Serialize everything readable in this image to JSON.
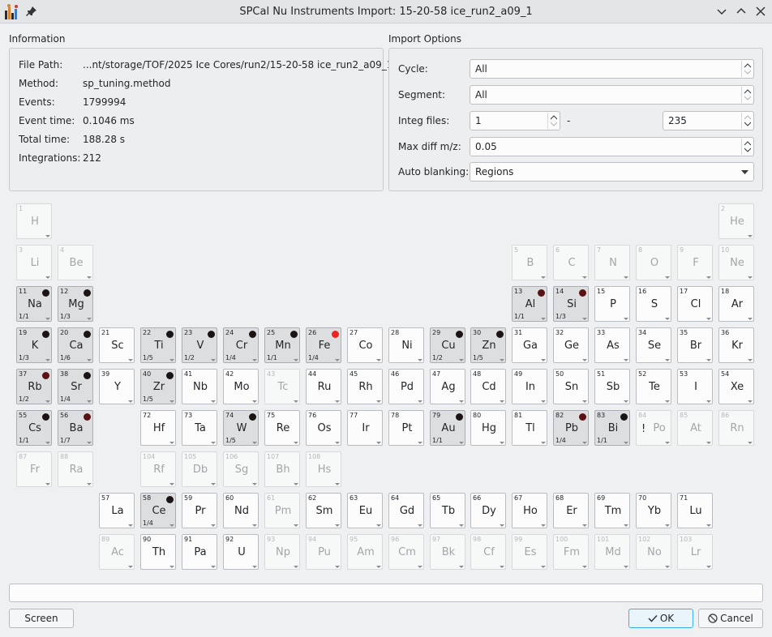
{
  "window": {
    "title": "SPCal Nu Instruments Import: 15-20-58 ice_run2_a09_1"
  },
  "information": {
    "title": "Information",
    "rows": [
      {
        "label": "File Path:",
        "value": "...nt/storage/TOF/2025 Ice Cores/run2/15-20-58 ice_run2_a09_1"
      },
      {
        "label": "Method:",
        "value": "sp_tuning.method"
      },
      {
        "label": "Events:",
        "value": "1799994"
      },
      {
        "label": "Event time:",
        "value": "0.1046 ms"
      },
      {
        "label": "Total time:",
        "value": "188.28 s"
      },
      {
        "label": "Integrations:",
        "value": "212"
      }
    ]
  },
  "import_options": {
    "title": "Import Options",
    "cycle": {
      "label": "Cycle:",
      "value": "All"
    },
    "segment": {
      "label": "Segment:",
      "value": "All"
    },
    "integ_files": {
      "label": "Integ files:",
      "from": "1",
      "separator": "-",
      "to": "235"
    },
    "max_diff": {
      "label": "Max diff m/z:",
      "value": "0.05"
    },
    "auto_blanking": {
      "label": "Auto blanking:",
      "value": "Regions"
    }
  },
  "colors": {
    "dot_dark": "#1a1414",
    "dot_darkred": "#5b1212",
    "dot_red": "#ef2222"
  },
  "elements": [
    {
      "n": "1",
      "s": "H",
      "st": "dis"
    },
    {
      "n": "2",
      "s": "He",
      "st": "dis"
    },
    {
      "n": "3",
      "s": "Li",
      "st": "dis"
    },
    {
      "n": "4",
      "s": "Be",
      "st": "dis"
    },
    {
      "n": "5",
      "s": "B",
      "st": "dis"
    },
    {
      "n": "6",
      "s": "C",
      "st": "dis"
    },
    {
      "n": "7",
      "s": "N",
      "st": "dis"
    },
    {
      "n": "8",
      "s": "O",
      "st": "dis"
    },
    {
      "n": "9",
      "s": "F",
      "st": "dis"
    },
    {
      "n": "10",
      "s": "Ne",
      "st": "dis"
    },
    {
      "n": "11",
      "s": "Na",
      "st": "sel",
      "r": "1/1",
      "d": "dark"
    },
    {
      "n": "12",
      "s": "Mg",
      "st": "sel",
      "r": "1/3",
      "d": "dark"
    },
    {
      "n": "13",
      "s": "Al",
      "st": "sel",
      "r": "1/1",
      "d": "darkred"
    },
    {
      "n": "14",
      "s": "Si",
      "st": "sel",
      "r": "1/3",
      "d": "darkred"
    },
    {
      "n": "15",
      "s": "P",
      "st": "en"
    },
    {
      "n": "16",
      "s": "S",
      "st": "en"
    },
    {
      "n": "17",
      "s": "Cl",
      "st": "en"
    },
    {
      "n": "18",
      "s": "Ar",
      "st": "en"
    },
    {
      "n": "19",
      "s": "K",
      "st": "sel",
      "r": "1/3",
      "d": "dark"
    },
    {
      "n": "20",
      "s": "Ca",
      "st": "sel",
      "r": "1/6",
      "d": "dark"
    },
    {
      "n": "21",
      "s": "Sc",
      "st": "en"
    },
    {
      "n": "22",
      "s": "Ti",
      "st": "sel",
      "r": "1/5",
      "d": "dark"
    },
    {
      "n": "23",
      "s": "V",
      "st": "sel",
      "r": "1/2",
      "d": "dark"
    },
    {
      "n": "24",
      "s": "Cr",
      "st": "sel",
      "r": "1/4",
      "d": "dark"
    },
    {
      "n": "25",
      "s": "Mn",
      "st": "sel",
      "r": "1/1",
      "d": "dark"
    },
    {
      "n": "26",
      "s": "Fe",
      "st": "sel",
      "r": "1/4",
      "d": "red"
    },
    {
      "n": "27",
      "s": "Co",
      "st": "en"
    },
    {
      "n": "28",
      "s": "Ni",
      "st": "en"
    },
    {
      "n": "29",
      "s": "Cu",
      "st": "sel",
      "r": "1/2",
      "d": "dark"
    },
    {
      "n": "30",
      "s": "Zn",
      "st": "sel",
      "r": "1/5",
      "d": "dark"
    },
    {
      "n": "31",
      "s": "Ga",
      "st": "en"
    },
    {
      "n": "32",
      "s": "Ge",
      "st": "en"
    },
    {
      "n": "33",
      "s": "As",
      "st": "en"
    },
    {
      "n": "34",
      "s": "Se",
      "st": "en"
    },
    {
      "n": "35",
      "s": "Br",
      "st": "en"
    },
    {
      "n": "36",
      "s": "Kr",
      "st": "en"
    },
    {
      "n": "37",
      "s": "Rb",
      "st": "sel",
      "r": "1/2",
      "d": "darkred"
    },
    {
      "n": "38",
      "s": "Sr",
      "st": "sel",
      "r": "1/4",
      "d": "dark"
    },
    {
      "n": "39",
      "s": "Y",
      "st": "en"
    },
    {
      "n": "40",
      "s": "Zr",
      "st": "sel",
      "r": "1/5",
      "d": "dark"
    },
    {
      "n": "41",
      "s": "Nb",
      "st": "en"
    },
    {
      "n": "42",
      "s": "Mo",
      "st": "en"
    },
    {
      "n": "43",
      "s": "Tc",
      "st": "dis"
    },
    {
      "n": "44",
      "s": "Ru",
      "st": "en"
    },
    {
      "n": "45",
      "s": "Rh",
      "st": "en"
    },
    {
      "n": "46",
      "s": "Pd",
      "st": "en"
    },
    {
      "n": "47",
      "s": "Ag",
      "st": "en"
    },
    {
      "n": "48",
      "s": "Cd",
      "st": "en"
    },
    {
      "n": "49",
      "s": "In",
      "st": "en"
    },
    {
      "n": "50",
      "s": "Sn",
      "st": "en"
    },
    {
      "n": "51",
      "s": "Sb",
      "st": "en"
    },
    {
      "n": "52",
      "s": "Te",
      "st": "en"
    },
    {
      "n": "53",
      "s": "I",
      "st": "en"
    },
    {
      "n": "54",
      "s": "Xe",
      "st": "en"
    },
    {
      "n": "55",
      "s": "Cs",
      "st": "sel",
      "r": "1/1",
      "d": "dark"
    },
    {
      "n": "56",
      "s": "Ba",
      "st": "sel",
      "r": "1/7",
      "d": "darkred"
    },
    {
      "n": "72",
      "s": "Hf",
      "st": "en"
    },
    {
      "n": "73",
      "s": "Ta",
      "st": "en"
    },
    {
      "n": "74",
      "s": "W",
      "st": "sel",
      "r": "1/5",
      "d": "dark"
    },
    {
      "n": "75",
      "s": "Re",
      "st": "en"
    },
    {
      "n": "76",
      "s": "Os",
      "st": "en"
    },
    {
      "n": "77",
      "s": "Ir",
      "st": "en"
    },
    {
      "n": "78",
      "s": "Pt",
      "st": "en"
    },
    {
      "n": "79",
      "s": "Au",
      "st": "sel",
      "r": "1/1",
      "d": "dark"
    },
    {
      "n": "80",
      "s": "Hg",
      "st": "en"
    },
    {
      "n": "81",
      "s": "Tl",
      "st": "en"
    },
    {
      "n": "82",
      "s": "Pb",
      "st": "sel",
      "r": "1/4",
      "d": "darkred"
    },
    {
      "n": "83",
      "s": "Bi",
      "st": "sel",
      "r": "1/1",
      "d": "dark"
    },
    {
      "n": "84",
      "s": "Po",
      "st": "dis",
      "w": "!"
    },
    {
      "n": "85",
      "s": "At",
      "st": "dis"
    },
    {
      "n": "86",
      "s": "Rn",
      "st": "dis"
    },
    {
      "n": "87",
      "s": "Fr",
      "st": "dis"
    },
    {
      "n": "88",
      "s": "Ra",
      "st": "dis"
    },
    {
      "n": "104",
      "s": "Rf",
      "st": "dis"
    },
    {
      "n": "105",
      "s": "Db",
      "st": "dis"
    },
    {
      "n": "106",
      "s": "Sg",
      "st": "dis"
    },
    {
      "n": "107",
      "s": "Bh",
      "st": "dis"
    },
    {
      "n": "108",
      "s": "Hs",
      "st": "dis"
    },
    {
      "n": "57",
      "s": "La",
      "st": "en"
    },
    {
      "n": "58",
      "s": "Ce",
      "st": "sel",
      "r": "1/4",
      "d": "dark"
    },
    {
      "n": "59",
      "s": "Pr",
      "st": "en"
    },
    {
      "n": "60",
      "s": "Nd",
      "st": "en"
    },
    {
      "n": "61",
      "s": "Pm",
      "st": "dis"
    },
    {
      "n": "62",
      "s": "Sm",
      "st": "en"
    },
    {
      "n": "63",
      "s": "Eu",
      "st": "en"
    },
    {
      "n": "64",
      "s": "Gd",
      "st": "en"
    },
    {
      "n": "65",
      "s": "Tb",
      "st": "en"
    },
    {
      "n": "66",
      "s": "Dy",
      "st": "en"
    },
    {
      "n": "67",
      "s": "Ho",
      "st": "en"
    },
    {
      "n": "68",
      "s": "Er",
      "st": "en"
    },
    {
      "n": "69",
      "s": "Tm",
      "st": "en"
    },
    {
      "n": "70",
      "s": "Yb",
      "st": "en"
    },
    {
      "n": "71",
      "s": "Lu",
      "st": "en"
    },
    {
      "n": "89",
      "s": "Ac",
      "st": "dis"
    },
    {
      "n": "90",
      "s": "Th",
      "st": "en"
    },
    {
      "n": "91",
      "s": "Pa",
      "st": "en"
    },
    {
      "n": "92",
      "s": "U",
      "st": "en"
    },
    {
      "n": "93",
      "s": "Np",
      "st": "dis"
    },
    {
      "n": "94",
      "s": "Pu",
      "st": "dis"
    },
    {
      "n": "95",
      "s": "Am",
      "st": "dis"
    },
    {
      "n": "96",
      "s": "Cm",
      "st": "dis"
    },
    {
      "n": "97",
      "s": "Bk",
      "st": "dis"
    },
    {
      "n": "98",
      "s": "Cf",
      "st": "dis"
    },
    {
      "n": "99",
      "s": "Es",
      "st": "dis"
    },
    {
      "n": "100",
      "s": "Fm",
      "st": "dis"
    },
    {
      "n": "101",
      "s": "Md",
      "st": "dis"
    },
    {
      "n": "102",
      "s": "No",
      "st": "dis"
    },
    {
      "n": "103",
      "s": "Lr",
      "st": "dis"
    }
  ],
  "bottom": {
    "filter_value": "",
    "screen_label": "Screen",
    "ok_label": "OK",
    "cancel_label": "Cancel"
  }
}
